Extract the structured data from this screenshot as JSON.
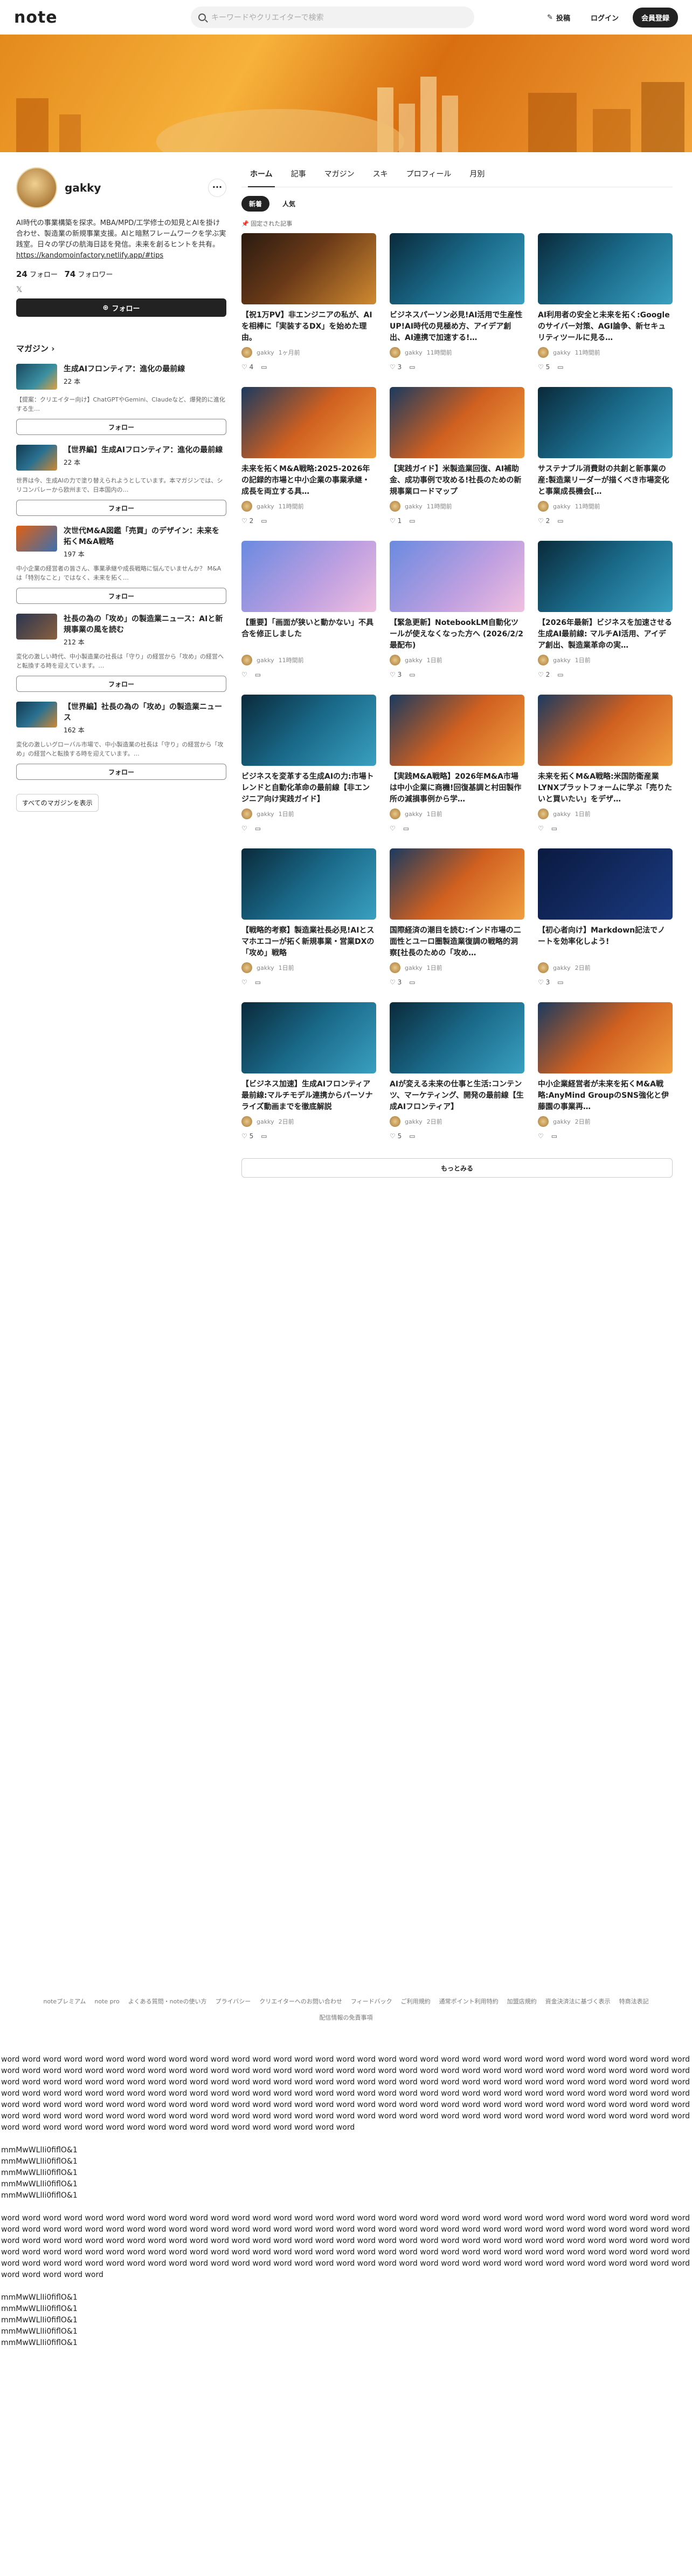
{
  "header": {
    "logo": "note",
    "search_placeholder": "キーワードやクリエイターで検索",
    "post_label": "投稿",
    "login_label": "ログイン",
    "signup_label": "会員登録"
  },
  "profile": {
    "name": "gakky",
    "bio": "AI時代の事業構築を探求。MBA/MPD/工学修士の知見とAIを掛け合わせ、製造業の新規事業支援。AIと暗黙フレームワークを学ぶ実践室。日々の学びの航海日誌を発信。未来を創るヒントを共有。",
    "link": "https://kandomoinfactory.netlify.app/#tips",
    "follow_count": "24",
    "follow_label": "フォロー",
    "follower_count": "74",
    "follower_label": "フォロワー",
    "follow_button": "フォロー"
  },
  "magazines": {
    "heading": "マガジン",
    "items": [
      {
        "title": "生成AIフロンティア：進化の最前線",
        "count": "22 本",
        "desc": "【提案：クリエイター向け】ChatGPTやGemini、Claudeなど、爆発的に進化する生…",
        "follow": "フォロー"
      },
      {
        "title": "【世界編】生成AIフロンティア：進化の最前線",
        "count": "22 本",
        "desc": "世界は今、生成AIの力で塗り替えられようとしています。本マガジンでは、シリコンバレーから欧州まで、日本国内の…",
        "follow": "フォロー"
      },
      {
        "title": "次世代M&A図鑑「売買」のデザイン：未来を拓くM&A戦略",
        "count": "197 本",
        "desc": "中小企業の経営者の皆さん、事業承継や成長戦略に悩んでいませんか？ M&Aは「特別なこと」ではなく、未来を拓く…",
        "follow": "フォロー"
      },
      {
        "title": "社長の為の「攻め」の製造業ニュース：AIと新規事業の風を読む",
        "count": "212 本",
        "desc": "変化の激しい時代、中小製造業の社長は「守り」の経営から「攻め」の経営へと転換する時を迎えています。…",
        "follow": "フォロー"
      },
      {
        "title": "【世界編】社長の為の「攻め」の製造業ニュース",
        "count": "162 本",
        "desc": "変化の激しいグローバル市場で、中小製造業の社長は「守り」の経営から「攻め」の経営へと転換する時を迎えています。…",
        "follow": "フォロー"
      }
    ],
    "all_label": "すべてのマガジンを表示"
  },
  "tabs": [
    "ホーム",
    "記事",
    "マガジン",
    "スキ",
    "プロフィール",
    "月別"
  ],
  "pills": [
    "新着",
    "人気"
  ],
  "pinned_label": "固定された記事",
  "articles": [
    {
      "title": "【祝1万PV】非エンジニアの私が、AIを相棒に「実装するDX」を始めた理由。",
      "date": "1ヶ月前",
      "likes": "4"
    },
    {
      "title": "ビジネスパーソン必見!AI活用で生産性UP!AI時代の見極め方、アイデア創出、AI連携で加速する!…",
      "date": "11時間前",
      "likes": "3"
    },
    {
      "title": "AI利用者の安全と未来を拓く:Googleのサイバー対策、AGI論争、新セキュリティツールに見る…",
      "date": "11時間前",
      "likes": "5"
    },
    {
      "title": "未来を拓くM&A戦略:2025-2026年の記録的市場と中小企業の事業承継・成長を両立する具…",
      "date": "11時間前",
      "likes": "2"
    },
    {
      "title": "【実践ガイド】米製造業回復、AI補助金、成功事例で攻める!社長のための新規事業ロードマップ",
      "date": "11時間前",
      "likes": "1"
    },
    {
      "title": "サステナブル消費財の共創と新事業の産:製造業リーダーが描くべき市場変化と事業成長機会[…",
      "date": "11時間前",
      "likes": "2"
    },
    {
      "title": "【重要】「画面が狭いと動かない」不具合を修正しました",
      "date": "11時間前",
      "likes": ""
    },
    {
      "title": "【緊急更新】NotebookLM自動化ツールが使えなくなった方へ (2026/2/2最配布)",
      "date": "1日前",
      "likes": "3"
    },
    {
      "title": "【2026年最新】ビジネスを加速させる生成AI最前線: マルチAI活用、アイデア創出、製造業革命の実…",
      "date": "1日前",
      "likes": "2"
    },
    {
      "title": "ビジネスを変革する生成AIの力:市場トレンドと自動化革命の最前線【非エンジニア向け実践ガイド】",
      "date": "1日前",
      "likes": ""
    },
    {
      "title": "【実践M&A戦略】2026年M&A市場は中小企業に商機!回復基調と村田製作所の減損事例から学…",
      "date": "1日前",
      "likes": ""
    },
    {
      "title": "未来を拓くM&A戦略:米国防衛産業LYNXプラットフォームに学ぶ「売りたいと買いたい」をデザ…",
      "date": "1日前",
      "likes": ""
    },
    {
      "title": "【戦略的考察】製造業社長必見!AIとスマホエコーが拓く新規事業・営業DXの「攻め」戦略",
      "date": "1日前",
      "likes": ""
    },
    {
      "title": "国際経済の潮目を読む:インド市場の二面性とユーロ圏製造業復調の戦略的洞察[社長のための「攻め…",
      "date": "1日前",
      "likes": "3"
    },
    {
      "title": "【初心者向け】Markdown記法でノートを効率化しよう!",
      "date": "2日前",
      "likes": "3"
    },
    {
      "title": "【ビジネス加速】生成AIフロンティア最前線:マルチモデル連携からパーソナライズ動画までを徹底解説",
      "date": "2日前",
      "likes": "5"
    },
    {
      "title": "AIが変える未来の仕事と生活:コンテンツ、マーケティング、開発の最前線【生成AIフロンティア】",
      "date": "2日前",
      "likes": "5"
    },
    {
      "title": "中小企業経営者が未来を拓くM&A戦略:AnyMind GroupのSNS強化と伊藤園の事業再…",
      "date": "2日前",
      "likes": ""
    }
  ],
  "author": "gakky",
  "more_label": "もっとみる",
  "footer_links": [
    "noteプレミアム",
    "note pro",
    "よくある質問・noteの使い方",
    "プライバシー",
    "クリエイターへのお問い合わせ",
    "フィードバック",
    "ご利用規約",
    "通常ポイント利用特約",
    "加盟店規約",
    "資金決済法に基づく表示",
    "特商法表記",
    "配信情報の免責事項"
  ],
  "junk_word": "word",
  "junk_chars": [
    "mmMwWLlIi0fiflO&1",
    "mmMwWLlIi0fiflO&1",
    "mmMwWLlIi0fiflO&1",
    "mmMwWLlIi0fiflO&1",
    "mmMwWLlIi0fiflO&1"
  ]
}
